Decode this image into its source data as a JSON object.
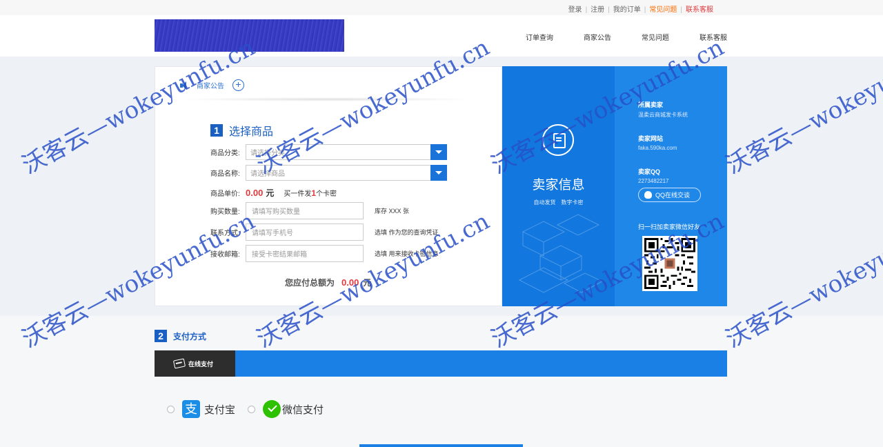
{
  "top_links": {
    "login": "登录",
    "register": "注册",
    "my_orders": "我的订单",
    "faq": "常见问题",
    "contact": "联系客服"
  },
  "nav": [
    "订单查询",
    "商家公告",
    "常见问题",
    "联系客服"
  ],
  "notice": {
    "label": "商家公告"
  },
  "step1": {
    "num": "1",
    "title": "选择商品",
    "category_label": "商品分类:",
    "category_placeholder": "请选择分类",
    "product_label": "商品名称:",
    "product_placeholder": "请选择商品",
    "price_label": "商品单价:",
    "price_value": "0.00",
    "price_unit": "元",
    "price_note_prefix": "买一件发",
    "price_note_count": "1",
    "price_note_suffix": "个卡密",
    "qty_label": "购买数量:",
    "qty_placeholder": "请填写购买数量",
    "stock_hint": "库存 XXX 张",
    "contact_label": "联系方式:",
    "contact_placeholder": "请填写手机号",
    "contact_hint": "选填 作为您的查询凭证",
    "email_label": "接收邮箱:",
    "email_placeholder": "接受卡密结果邮箱",
    "email_hint": "选填 用来接收卡密信息",
    "total_label": "您应付总额为",
    "total_value": "0.00",
    "total_unit": "元"
  },
  "seller": {
    "title": "卖家信息",
    "sub1": "自动发货",
    "sub2": "数字卡密",
    "owner_label": "所属卖家",
    "owner_value": "温柔云商城发卡系统",
    "site_label": "卖家网站",
    "site_value": "faka.590ka.com",
    "qq_label": "卖家QQ",
    "qq_value": "2273482217",
    "qq_button": "QQ在线交谈",
    "wechat_note": "扫一扫加卖家微信好友"
  },
  "step2": {
    "num": "2",
    "title": "支付方式",
    "tab_label": "在线支付",
    "alipay": "支付宝",
    "wechat": "微信支付"
  },
  "watermark": "沃客云—wokeyunfu.cn",
  "colors": {
    "primary": "#1a80e6",
    "accent_red": "#e4393c",
    "accent_orange": "#ff6a00",
    "dark_tab": "#2d2d2d"
  }
}
